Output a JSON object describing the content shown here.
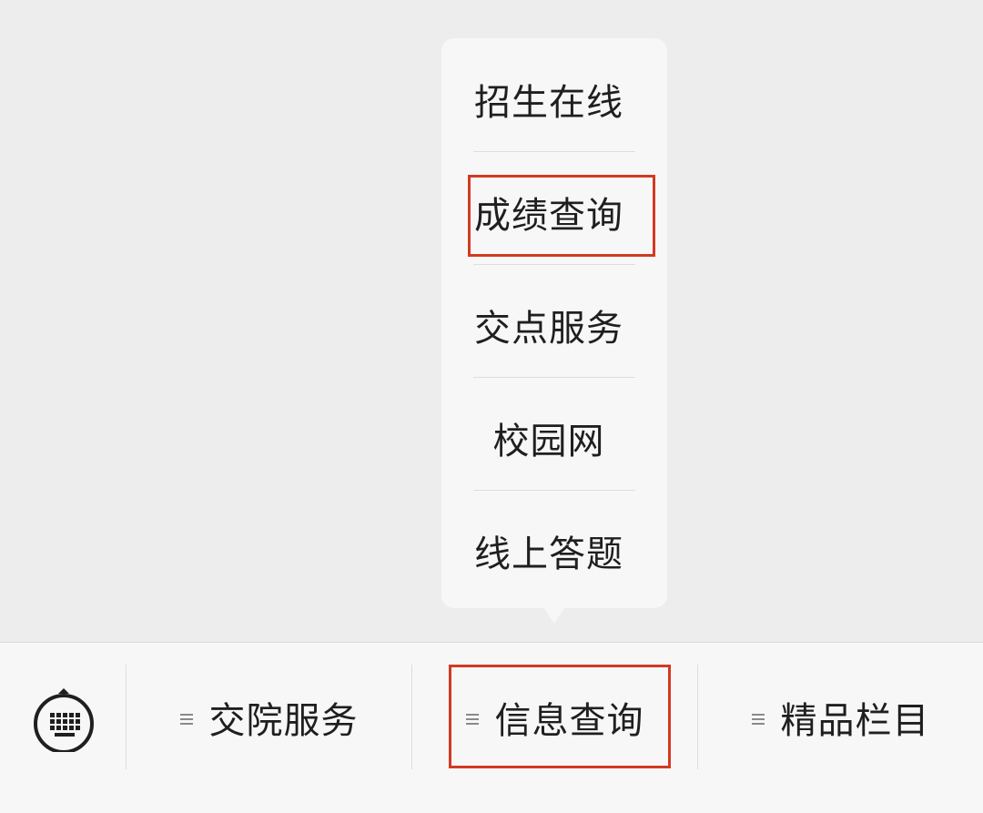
{
  "popup_menu": {
    "items": [
      {
        "label": "招生在线"
      },
      {
        "label": "成绩查询"
      },
      {
        "label": "交点服务"
      },
      {
        "label": "校园网"
      },
      {
        "label": "线上答题"
      }
    ],
    "highlighted_item": "成绩查询"
  },
  "tab_bar": {
    "keyboard_icon": "keyboard-icon",
    "tabs": [
      {
        "label": "交院服务",
        "icon": "menu-icon"
      },
      {
        "label": "信息查询",
        "icon": "menu-icon",
        "highlighted": true
      },
      {
        "label": "精品栏目",
        "icon": "menu-icon"
      }
    ]
  },
  "colors": {
    "background": "#ededed",
    "surface": "#f7f7f7",
    "highlight_border": "#d23a22",
    "text": "#1f1f1f"
  }
}
